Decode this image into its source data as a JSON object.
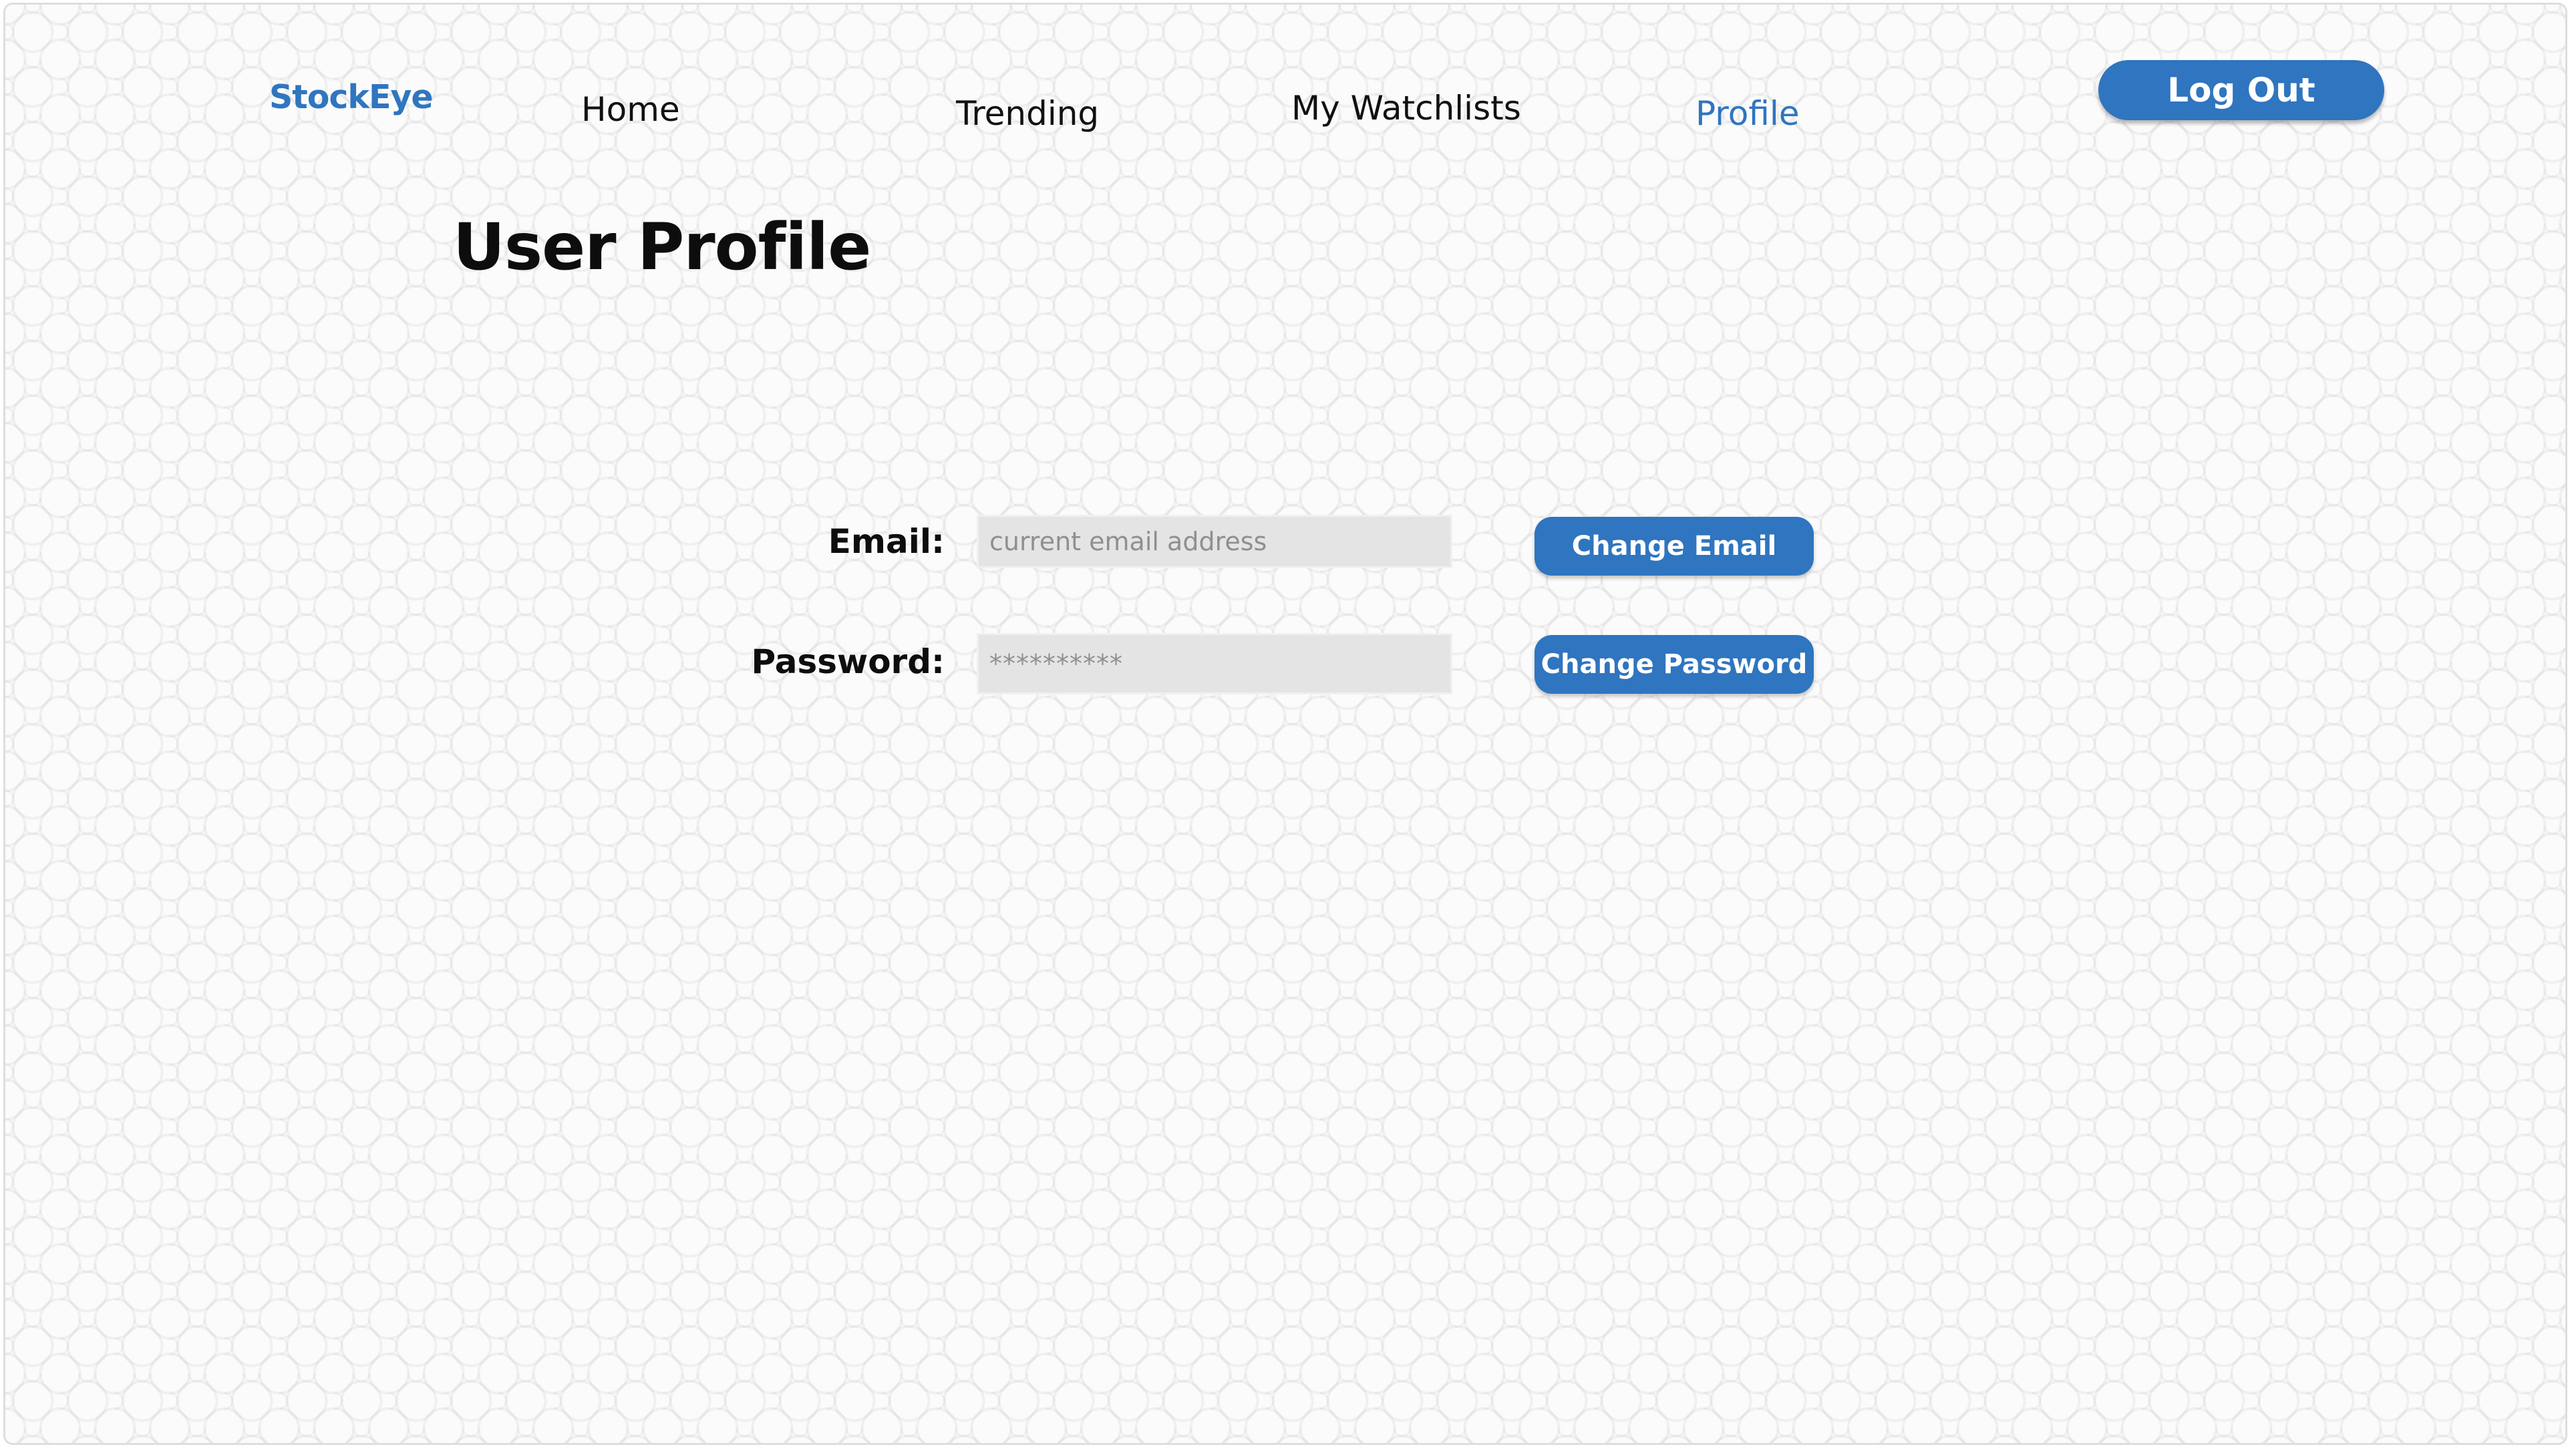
{
  "nav": {
    "brand": "StockEye",
    "home": "Home",
    "trending": "Trending",
    "watchlists": "My Watchlists",
    "profile": "Profile",
    "logout": "Log Out"
  },
  "page": {
    "title": "User Profile"
  },
  "form": {
    "email_label": "Email:",
    "email_value": "",
    "email_placeholder": "current email address",
    "password_label": "Password:",
    "password_value": "",
    "password_placeholder": "**********",
    "change_email_label": "Change Email",
    "change_password_label": "Change Password"
  },
  "colors": {
    "accent": "#2f75bf",
    "input_bg": "#e4e4e4",
    "text": "#0d0d0d"
  }
}
